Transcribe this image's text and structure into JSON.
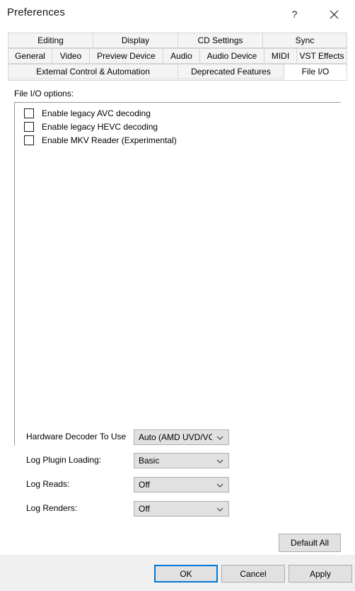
{
  "window": {
    "title": "Preferences",
    "help_icon": "question-mark-icon",
    "close_icon": "close-icon",
    "accent_color": "#0078d7"
  },
  "tabs": {
    "row1": [
      {
        "label": "Editing",
        "selected": false
      },
      {
        "label": "Display",
        "selected": false
      },
      {
        "label": "CD Settings",
        "selected": false
      },
      {
        "label": "Sync",
        "selected": false
      }
    ],
    "row2": [
      {
        "label": "General",
        "selected": false
      },
      {
        "label": "Video",
        "selected": false
      },
      {
        "label": "Preview Device",
        "selected": false
      },
      {
        "label": "Audio",
        "selected": false
      },
      {
        "label": "Audio Device",
        "selected": false
      },
      {
        "label": "MIDI",
        "selected": false
      },
      {
        "label": "VST Effects",
        "selected": false
      }
    ],
    "row3": [
      {
        "label": "External Control & Automation",
        "selected": false
      },
      {
        "label": "Deprecated Features",
        "selected": false
      },
      {
        "label": "File I/O",
        "selected": true
      }
    ]
  },
  "content": {
    "options_label": "File I/O options:",
    "checkboxes": [
      {
        "label": "Enable legacy AVC decoding",
        "checked": false
      },
      {
        "label": "Enable legacy HEVC decoding",
        "checked": false
      },
      {
        "label": "Enable MKV Reader (Experimental)",
        "checked": false
      }
    ],
    "settings": [
      {
        "label": "Hardware Decoder To Use",
        "value": "Auto (AMD UVD/VCI"
      },
      {
        "label": "Log Plugin Loading:",
        "value": "Basic"
      },
      {
        "label": "Log Reads:",
        "value": "Off"
      },
      {
        "label": "Log Renders:",
        "value": "Off"
      }
    ],
    "default_all_label": "Default All"
  },
  "footer": {
    "ok_label": "OK",
    "cancel_label": "Cancel",
    "apply_label": "Apply"
  }
}
